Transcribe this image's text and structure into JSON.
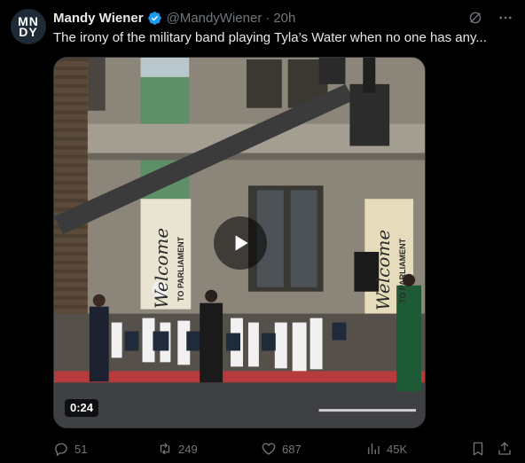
{
  "author": {
    "avatar_line1": "MN",
    "avatar_line2": "DY",
    "name": "Mandy Wiener",
    "handle": "@MandyWiener",
    "separator": "·",
    "time": "20h",
    "verified_color": "#1d9bf0"
  },
  "tweet": {
    "text": "The irony of the military band playing Tyla’s Water when no one has any..."
  },
  "media": {
    "duration": "0:24",
    "banner_left_script": "Welcome",
    "banner_left_caps": "TO PARLIAMENT",
    "banner_right_script": "Welcome",
    "banner_right_caps": "TO PARLIAMENT"
  },
  "actions": {
    "replies": "51",
    "reposts": "249",
    "likes": "687",
    "views": "45K"
  },
  "colors": {
    "background": "#000000",
    "text": "#e7e9ea",
    "muted": "#71767b"
  }
}
